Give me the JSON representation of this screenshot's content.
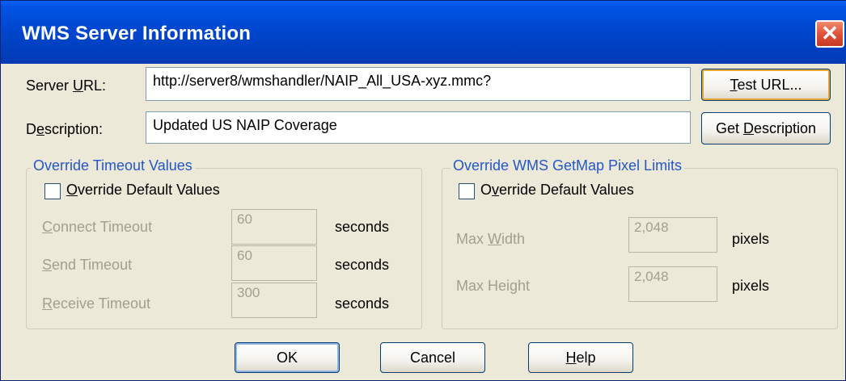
{
  "window": {
    "title": "WMS Server Information",
    "close_icon": "close-icon"
  },
  "server_url": {
    "label_pre": "Server ",
    "label_u": "U",
    "label_post": "RL:",
    "value": "http://server8/wmshandler/NAIP_All_USA-xyz.mmc?"
  },
  "description": {
    "label_pre": "D",
    "label_u": "e",
    "label_post": "scription:",
    "value": "Updated US NAIP Coverage"
  },
  "buttons": {
    "test_url_u": "T",
    "test_url_rest": "est URL...",
    "get_desc_pre": "Get ",
    "get_desc_u": "D",
    "get_desc_post": "escription",
    "ok": "OK",
    "cancel": "Cancel",
    "help_u": "H",
    "help_rest": "elp"
  },
  "timeout_group": {
    "title": "Override Timeout Values",
    "override_u": "O",
    "override_rest": "verride Default Values",
    "override_checked": false,
    "rows": [
      {
        "label_u": "C",
        "label_rest": "onnect Timeout",
        "value": "60",
        "unit": "seconds"
      },
      {
        "label_u": "S",
        "label_rest": "end Timeout",
        "value": "60",
        "unit": "seconds"
      },
      {
        "label_u": "R",
        "label_rest": "eceive Timeout",
        "value": "300",
        "unit": "seconds"
      }
    ]
  },
  "pixel_group": {
    "title": "Override WMS GetMap Pixel Limits",
    "override_pre": "O",
    "override_u": "v",
    "override_rest": "erride Default Values",
    "override_checked": false,
    "rows": [
      {
        "label_pre": "Max ",
        "label_u": "W",
        "label_rest": "idth",
        "value": "2,048",
        "unit": "pixels"
      },
      {
        "label_pre": "Max Height",
        "label_u": "",
        "label_rest": "",
        "value": "2,048",
        "unit": "pixels"
      }
    ]
  }
}
